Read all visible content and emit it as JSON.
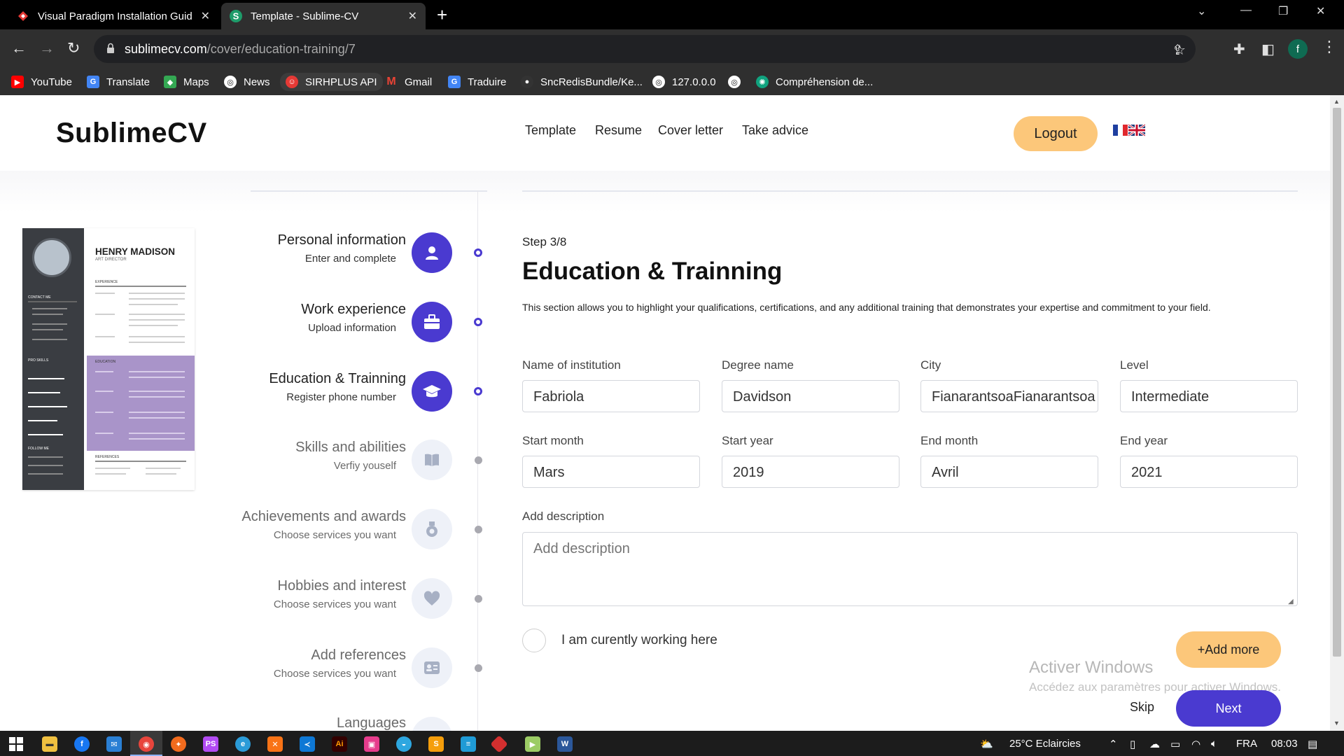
{
  "browser": {
    "tabs": [
      {
        "title": "Visual Paradigm Installation Guid",
        "active": false
      },
      {
        "title": "Template - Sublime-CV",
        "active": true
      }
    ],
    "url_host": "sublimecv.com",
    "url_path": "/cover/education-training/7",
    "profile_initial": "f",
    "bookmarks": [
      {
        "label": "YouTube",
        "icon": "youtube-icon",
        "color": "#ff0000"
      },
      {
        "label": "Translate",
        "icon": "translate-icon",
        "color": "#4285f4"
      },
      {
        "label": "Maps",
        "icon": "maps-icon",
        "color": "#34a853"
      },
      {
        "label": "News",
        "icon": "globe-icon",
        "color": "#ffffff"
      },
      {
        "label": "SIRHPLUS API",
        "icon": "sirhplus-icon",
        "color": "#e53935"
      },
      {
        "label": "Gmail",
        "icon": "gmail-icon",
        "color": "#ea4335"
      },
      {
        "label": "Traduire",
        "icon": "translate-icon",
        "color": "#4285f4"
      },
      {
        "label": "SncRedisBundle/Ke...",
        "icon": "github-icon",
        "color": "#333333"
      },
      {
        "label": "127.0.0.0",
        "icon": "globe-icon",
        "color": "#ffffff"
      },
      {
        "label": "",
        "icon": "globe-icon",
        "color": "#ffffff"
      },
      {
        "label": "Compréhension de...",
        "icon": "chatgpt-icon",
        "color": "#10a37f"
      }
    ]
  },
  "header": {
    "logo": "SublimeCV",
    "nav": [
      "Template",
      "Resume",
      "Cover letter",
      "Take advice"
    ],
    "logout_label": "Logout"
  },
  "cv_preview": {
    "name": "HENRY MADISON",
    "role": "ART DIRECTOR",
    "sections": [
      "EXPERIENCE",
      "EDUCATION",
      "REFERENCES"
    ],
    "side_sections": [
      "CONTACT ME",
      "PRO SKILLS",
      "FOLLOW ME"
    ]
  },
  "steps": [
    {
      "title": "Personal information",
      "subtitle": "Enter and complete",
      "active": true,
      "icon": "user-icon"
    },
    {
      "title": "Work experience",
      "subtitle": "Upload information",
      "active": true,
      "icon": "briefcase-icon"
    },
    {
      "title": "Education & Trainning",
      "subtitle": "Register phone number",
      "active": true,
      "icon": "graduation-cap-icon"
    },
    {
      "title": "Skills and abilities",
      "subtitle": "Verfiy youself",
      "active": false,
      "icon": "book-icon"
    },
    {
      "title": "Achievements and awards",
      "subtitle": "Choose services you want",
      "active": false,
      "icon": "award-icon"
    },
    {
      "title": "Hobbies and interest",
      "subtitle": "Choose services you want",
      "active": false,
      "icon": "heart-icon"
    },
    {
      "title": "Add references",
      "subtitle": "Choose services you want",
      "active": false,
      "icon": "id-card-icon"
    },
    {
      "title": "Languages",
      "subtitle": "",
      "active": false,
      "icon": "language-icon"
    }
  ],
  "form": {
    "step_label": "Step 3/8",
    "title": "Education & Trainning",
    "description": "This section allows you to highlight your qualifications, certifications, and any additional training that demonstrates your expertise and commitment to your field.",
    "fields": [
      {
        "label": "Name of institution",
        "value": "Fabriola"
      },
      {
        "label": "Degree name",
        "value": "Davidson"
      },
      {
        "label": "City",
        "value": "FianarantsoaFianarantsoa"
      },
      {
        "label": "Level",
        "value": "Intermediate"
      },
      {
        "label": "Start month",
        "value": "Mars"
      },
      {
        "label": "Start year",
        "value": "2019"
      },
      {
        "label": "End month",
        "value": "Avril"
      },
      {
        "label": "End year",
        "value": "2021"
      }
    ],
    "description_label": "Add description",
    "description_placeholder": "Add description",
    "working_here_label": "I am curently working here",
    "add_more_label": "+Add more",
    "skip_label": "Skip",
    "next_label": "Next"
  },
  "windows_watermark": {
    "line1": "Activer Windows",
    "line2": "Accédez aux paramètres pour activer Windows."
  },
  "taskbar": {
    "weather": "25°C  Eclaircies",
    "lang": "FRA",
    "time": "08:03"
  },
  "colors": {
    "accent": "#4a3ad0",
    "button_yellow": "#fcc77a"
  }
}
